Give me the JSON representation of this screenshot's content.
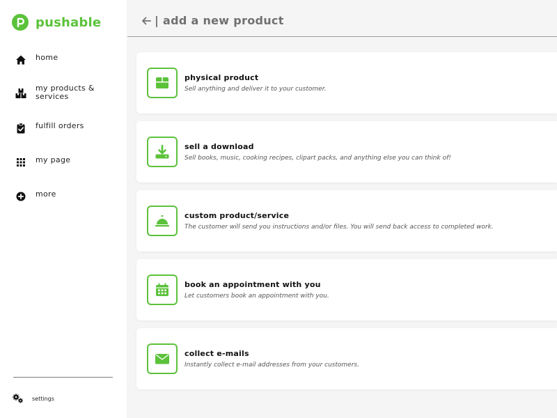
{
  "brand": {
    "name": "pushable",
    "color": "#5bc23a"
  },
  "sidebar": {
    "items": [
      {
        "label": "home",
        "icon": "home-icon"
      },
      {
        "label": "my products & services",
        "icon": "boxes-icon"
      },
      {
        "label": "fulfill orders",
        "icon": "clipboard-check-icon"
      },
      {
        "label": "my page",
        "icon": "grid-icon"
      },
      {
        "label": "more",
        "icon": "plus-circle-icon"
      }
    ],
    "settings_label": "settings"
  },
  "header": {
    "title": "| add a new product"
  },
  "products": [
    {
      "title": "physical product",
      "description": "Sell anything and deliver it to your customer.",
      "icon": "box-icon"
    },
    {
      "title": "sell a download",
      "description": "Sell books, music, cooking recipes, clipart packs, and anything else you can think of!",
      "icon": "download-icon"
    },
    {
      "title": "custom product/service",
      "description": "The customer will send you instructions and/or files. You will send back access to completed work.",
      "icon": "service-bell-icon"
    },
    {
      "title": "book an appointment with you",
      "description": "Let customers book an appointment with you.",
      "icon": "calendar-icon"
    },
    {
      "title": "collect e-mails",
      "description": "Instantly collect e-mail addresses from your customers.",
      "icon": "envelope-icon"
    }
  ]
}
